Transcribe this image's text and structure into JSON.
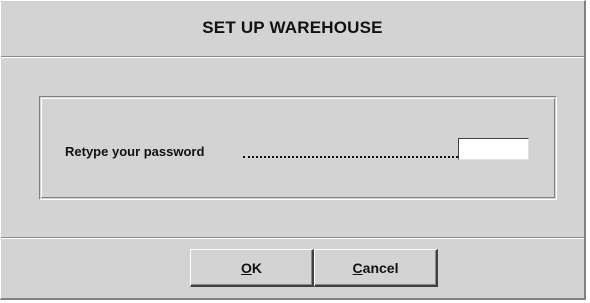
{
  "dialog": {
    "title": "SET UP WAREHOUSE"
  },
  "form": {
    "prompt_label": "Retype your password",
    "password_value": ""
  },
  "buttons": {
    "ok": {
      "mnemonic": "O",
      "rest": "K"
    },
    "cancel": {
      "mnemonic": "C",
      "rest": "ancel"
    }
  }
}
